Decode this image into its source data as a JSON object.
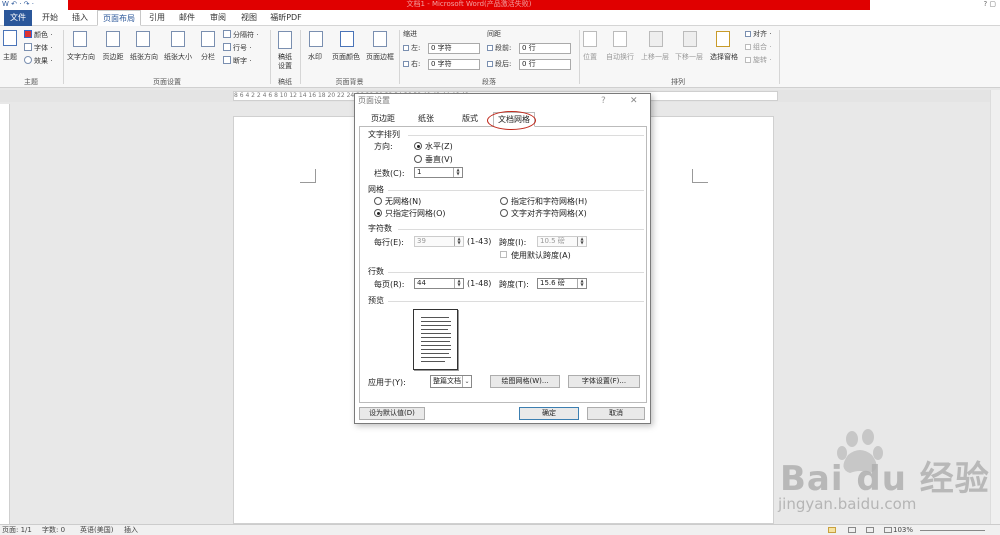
{
  "window": {
    "title": "文档1 - Microsoft Word(产品激活失败)",
    "qat": "W ↶ · ↷ ·",
    "controls": "?  ▢"
  },
  "tabs": [
    "文件",
    "开始",
    "插入",
    "页面布局",
    "引用",
    "邮件",
    "审阅",
    "视图",
    "福昕PDF"
  ],
  "ribbon": {
    "theme": {
      "big": "主题",
      "colors": "颜色 ·",
      "fonts": "字体 ·",
      "effects": "效果 ·",
      "group": "主题"
    },
    "page_setup": {
      "text_dir": "文字方向",
      "margins": "页边距",
      "orientation": "纸张方向",
      "size": "纸张大小",
      "columns": "分栏",
      "breaks": "分隔符 ·",
      "line_numbers": "行号 ·",
      "hyphenation": "断字 ·",
      "group": "页面设置"
    },
    "draft": {
      "label1": "稿纸",
      "label2": "设置",
      "group": "稿纸"
    },
    "bg": {
      "watermark": "水印",
      "page_color": "页面颜色",
      "page_border": "页面边框",
      "group": "页面背景"
    },
    "indent": {
      "header": "缩进",
      "left_label": "左:",
      "left_value": "0 字符",
      "right_label": "右:",
      "right_value": "0 字符"
    },
    "spacing": {
      "header": "间距",
      "before_label": "段前:",
      "before_value": "0 行",
      "after_label": "段后:",
      "after_value": "0 行"
    },
    "para_group": "段落",
    "arrange": {
      "position": "位置",
      "wrap": "自动换行",
      "forward": "上移一层",
      "backward": "下移一层",
      "pane": "选择窗格",
      "align": "对齐 ·",
      "group_obj": "组合 ·",
      "rotate": "旋转 ·",
      "group": "排列"
    }
  },
  "ruler": "8  6  4  2     2  4  6  8  10  12  14  16  18  20  22  24  26  28  30  32  34  36  38  40  42  44  46  48",
  "dialog": {
    "title": "页面设置",
    "help": "?",
    "close": "✕",
    "tabs": [
      "页边距",
      "纸张",
      "版式",
      "文档网格"
    ],
    "text_layout": {
      "header": "文字排列",
      "direction_label": "方向:",
      "horizontal": "水平(Z)",
      "vertical": "垂直(V)",
      "columns_label": "栏数(C):",
      "columns_value": "1"
    },
    "grid": {
      "header": "网格",
      "none": "无网格(N)",
      "lines_only": "只指定行网格(O)",
      "lines_and_chars": "指定行和字符网格(H)",
      "snap_chars": "文字对齐字符网格(X)"
    },
    "chars": {
      "header": "字符数",
      "per_line_label": "每行(E):",
      "per_line_value": "39",
      "per_line_range": "(1-43)",
      "pitch_label": "跨度(I):",
      "pitch_value": "10.5 磅",
      "use_default": "使用默认跨度(A)"
    },
    "lines": {
      "header": "行数",
      "per_page_label": "每页(R):",
      "per_page_value": "44",
      "per_page_range": "(1-48)",
      "pitch_label": "跨度(T):",
      "pitch_value": "15.6 磅"
    },
    "preview_header": "预览",
    "apply_label": "应用于(Y):",
    "apply_value": "整篇文档",
    "draw_grid": "绘图网格(W)...",
    "font_settings": "字体设置(F)...",
    "set_default": "设为默认值(D)",
    "ok": "确定",
    "cancel": "取消"
  },
  "status": {
    "page": "页面: 1/1",
    "words": "字数: 0",
    "lang": "英语(美国)",
    "mode": "插入",
    "zoom": "103%"
  },
  "watermark": {
    "brand": "Bai du 经验",
    "url": "jingyan.baidu.com"
  }
}
